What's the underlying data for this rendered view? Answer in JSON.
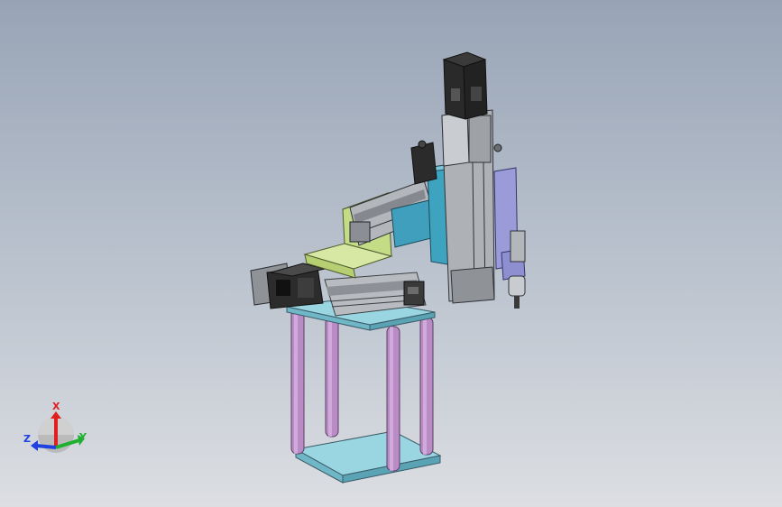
{
  "viewport": {
    "background_top": "#98a4b6",
    "background_bottom": "#dcdee2"
  },
  "model": {
    "parts": {
      "leg_color": "#c59bcf",
      "plate_color": "#8fcfdc",
      "bracket_color": "#cfe39a",
      "carriage_color": "#3ea3bf",
      "motor_color": "#2e2e2e",
      "rail_color": "#b9bcc0",
      "lavender_color": "#9a9bd8"
    }
  },
  "triad": {
    "x_label": "X",
    "y_label": "Y",
    "z_label": "Z",
    "x_color": "#e02020",
    "y_color": "#20b030",
    "z_color": "#2040e0"
  }
}
